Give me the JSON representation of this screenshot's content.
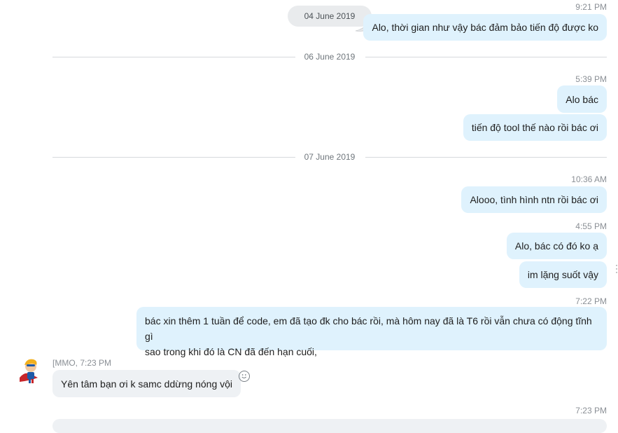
{
  "floating_date": "04 June 2019",
  "messages_top": {
    "time_1": "9:21 PM",
    "msg_1": "Alo,  thời gian như vậy bác đảm bảo tiến độ được ko"
  },
  "divider_1": "06 June 2019",
  "group_2": {
    "time": "5:39 PM",
    "msg_1": "Alo bác",
    "msg_2": "tiến độ tool thế nào rồi bác ơi"
  },
  "divider_2": "07 June 2019",
  "group_3": {
    "time_1": "10:36 AM",
    "msg_1": "Alooo, tình hình ntn rồi bác ơi",
    "time_2": "4:55 PM",
    "msg_2": "Alo, bác có đó ko ạ",
    "msg_3": "im lặng suốt vậy",
    "time_3": "7:22 PM",
    "msg_4_line1": "bác xin thêm 1 tuần để code, em đã tạo đk cho bác rồi, mà hôm nay đã là T6 rồi vẫn chưa có động tĩnh gì",
    "msg_4_line2": "sao trong khi đó là CN đã đến hạn cuối,"
  },
  "incoming": {
    "sender": "[MMO, 7:23 PM",
    "msg": "Yên tâm bạn ơi k samc ddừng nóng vội"
  },
  "bottom_time": "7:23 PM",
  "colors": {
    "outgoing_bubble": "#dff2fd",
    "incoming_bubble": "#eef1f4",
    "meta_text": "#8a8f95"
  },
  "icons": {
    "avatar": "superhero-avatar",
    "emoji": "smiley-reaction-icon"
  }
}
